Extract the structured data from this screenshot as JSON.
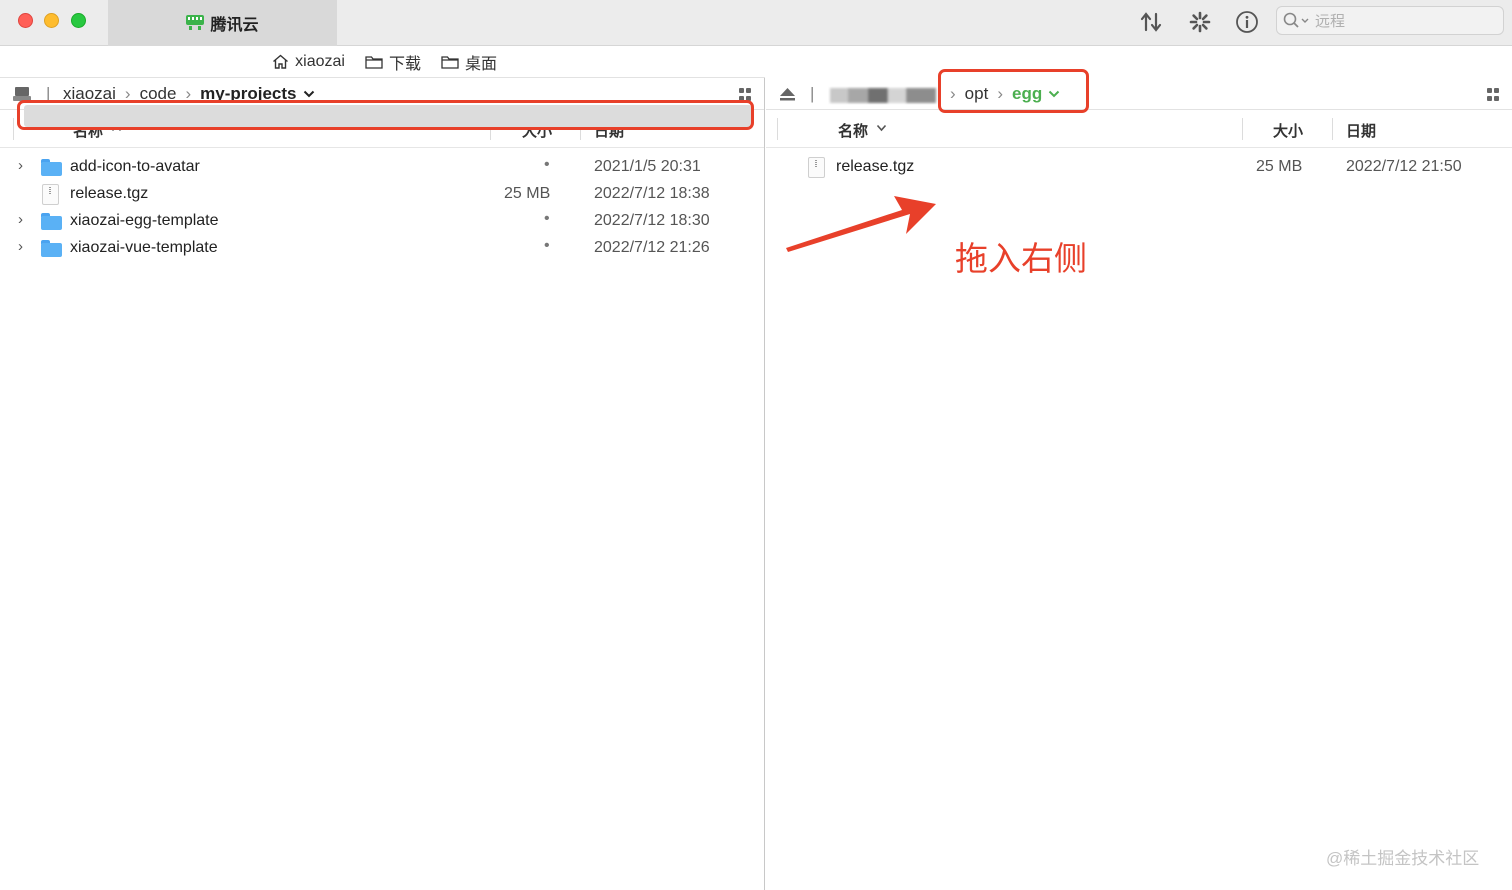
{
  "window": {
    "tab_title": "腾讯云",
    "search_placeholder": "远程"
  },
  "favorites": [
    {
      "label": "xiaozai",
      "icon": "home-icon"
    },
    {
      "label": "下载",
      "icon": "folder-icon"
    },
    {
      "label": "桌面",
      "icon": "folder-icon"
    }
  ],
  "left": {
    "path": [
      "xiaozai",
      "code",
      "my-projects"
    ],
    "columns": {
      "name": "名称",
      "size": "大小",
      "date": "日期"
    },
    "rows": [
      {
        "name": "add-icon-to-avatar",
        "size": "",
        "date": "2021/1/5 20:31",
        "type": "folder"
      },
      {
        "name": "release.tgz",
        "size": "25 MB",
        "date": "2022/7/12 18:38",
        "type": "file"
      },
      {
        "name": "xiaozai-egg-template",
        "size": "",
        "date": "2022/7/12 18:30",
        "type": "folder"
      },
      {
        "name": "xiaozai-vue-template",
        "size": "",
        "date": "2022/7/12 21:26",
        "type": "folder"
      }
    ],
    "dot": "•"
  },
  "right": {
    "path": [
      "opt",
      "egg"
    ],
    "columns": {
      "name": "名称",
      "size": "大小",
      "date": "日期"
    },
    "rows": [
      {
        "name": "release.tgz",
        "size": "25 MB",
        "date": "2022/7/12 21:50",
        "type": "file"
      }
    ]
  },
  "annotation": "拖入右侧",
  "watermark": "@稀土掘金技术社区",
  "colors": {
    "accent_red": "#e8402a",
    "path_green": "#4caf50",
    "folder_blue": "#5ab1f5"
  }
}
